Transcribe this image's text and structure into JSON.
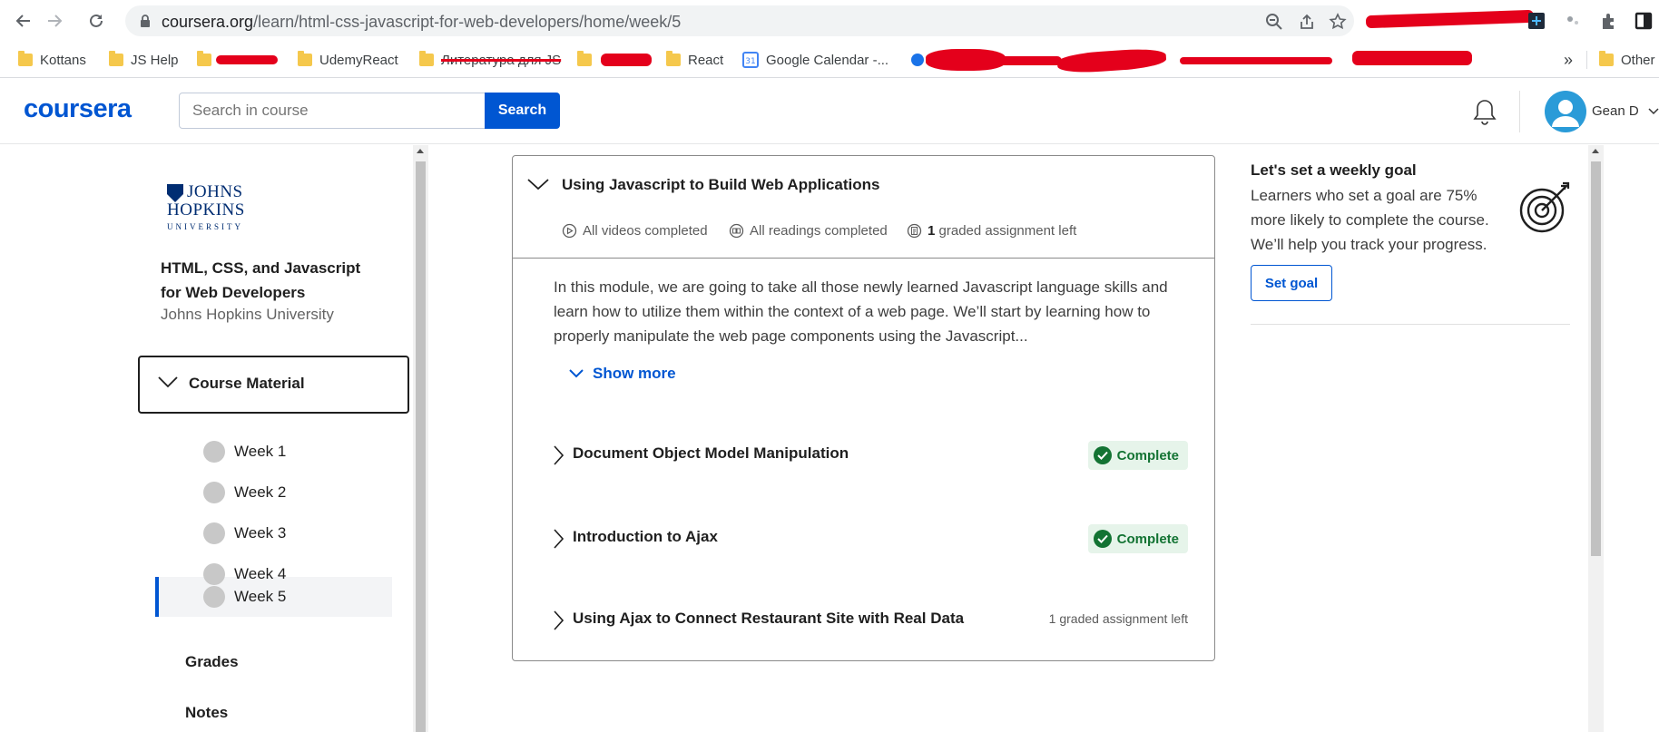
{
  "browser": {
    "url_host": "coursera.org",
    "url_path": "/learn/html-css-javascript-for-web-developers/home/week/5",
    "bookmarks": [
      {
        "label": "Kottans"
      },
      {
        "label": "JS Help"
      },
      {
        "label": "UdemyReact"
      },
      {
        "label": "Литература для JS"
      },
      {
        "label": "React"
      },
      {
        "label": "Google Calendar -..."
      },
      {
        "label": "Other"
      }
    ],
    "more_bookmarks": "»"
  },
  "header": {
    "logo": "coursera",
    "search_placeholder": "Search in course",
    "search_button": "Search",
    "username": "Gean D"
  },
  "sidebar": {
    "university_line1": "JOHNS",
    "university_line2": "HOPKINS",
    "university_line3": "UNIVERSITY",
    "course_title": "HTML, CSS, and Javascript for Web Developers",
    "course_org": "Johns Hopkins University",
    "course_material": "Course Material",
    "weeks": [
      {
        "label": "Week 1"
      },
      {
        "label": "Week 2"
      },
      {
        "label": "Week 3"
      },
      {
        "label": "Week 4"
      },
      {
        "label": "Week 5"
      }
    ],
    "active_week": "Week 5",
    "grades": "Grades",
    "notes": "Notes"
  },
  "module": {
    "title": "Using Javascript to Build Web Applications",
    "stats": {
      "videos": "All videos completed",
      "readings": "All readings completed",
      "graded_count": "1",
      "graded_text": "graded assignment left"
    },
    "description": "In this module, we are going to take all those newly learned Javascript language skills and learn how to utilize them within the context of a web page. We’ll start by learning how to properly manipulate the web page components using the Javascript...",
    "show_more": "Show more",
    "lessons": [
      {
        "name": "Document Object Model Manipulation",
        "status": "Complete"
      },
      {
        "name": "Introduction to Ajax",
        "status": "Complete"
      },
      {
        "name": "Using Ajax to Connect Restaurant Site with Real Data",
        "status": "1 graded assignment left"
      }
    ]
  },
  "goal": {
    "title": "Let's set a weekly goal",
    "text": "Learners who set a goal are 75% more likely to complete the course. We’ll help you track your progress.",
    "button": "Set goal"
  },
  "colors": {
    "brand": "#0056d2",
    "complete": "#137333",
    "complete_bg": "#e6f4ea"
  }
}
